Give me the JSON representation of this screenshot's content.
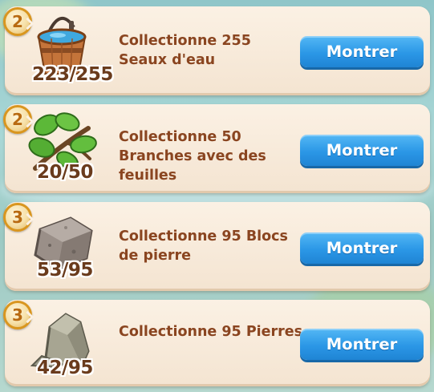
{
  "quests": [
    {
      "level": "2",
      "item_icon": "water-bucket-icon",
      "progress_text": "223/255",
      "description": "Collectionne 255 Seaux d'eau",
      "button_label": "Montrer"
    },
    {
      "level": "2",
      "item_icon": "leafy-branch-icon",
      "progress_text": "20/50",
      "description": "Collectionne 50 Branches avec des feuilles",
      "button_label": "Montrer"
    },
    {
      "level": "3",
      "item_icon": "stone-block-icon",
      "progress_text": "53/95",
      "description": "Collectionne 95 Blocs de pierre",
      "button_label": "Montrer"
    },
    {
      "level": "3",
      "item_icon": "rock-icon",
      "progress_text": "42/95",
      "description": "Collectionne 95 Pierres",
      "button_label": "Montrer"
    }
  ],
  "colors": {
    "button": "#2b97e6",
    "quest_text": "#8a4520",
    "count_text": "#6a3b1c",
    "badge_ring": "#d9961f"
  }
}
